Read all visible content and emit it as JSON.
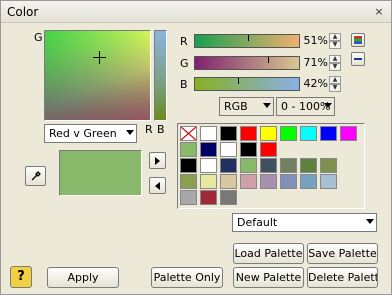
{
  "window": {
    "title": "Color",
    "close_glyph": "×"
  },
  "picker": {
    "axis_g": "G",
    "axis_r": "R",
    "axis_b": "B",
    "mode": "Red v Green"
  },
  "sliders": [
    {
      "label": "R",
      "value": "51%",
      "fraction": 0.51
    },
    {
      "label": "G",
      "value": "71%",
      "fraction": 0.71
    },
    {
      "label": "B",
      "value": "42%",
      "fraction": 0.42
    }
  ],
  "format": {
    "model": "RGB",
    "range": "0 - 100%"
  },
  "current_color": "#88b86a",
  "palette": {
    "selected": "Default",
    "rows": [
      [
        "none",
        "#ffffff",
        "#000000",
        "#ff0000",
        "#ffff00",
        "#00ff00",
        "#00ffff",
        "#0000ff",
        "#ff00ff"
      ],
      [
        "#88b86a",
        "#000066",
        "#ffffff",
        "#000000",
        "#ff0000",
        "",
        "",
        "",
        ""
      ],
      [
        "#000000",
        "#ffffff",
        "#203060",
        "#88b86a",
        "#405060",
        "#708060",
        "#608040",
        "#809050",
        ""
      ],
      [
        "#8aa050",
        "#e8e8a0",
        "#d8c8a0",
        "#d0a0a8",
        "#a890b0",
        "#8090b8",
        "#78a0c0",
        "#a8c0d0",
        ""
      ],
      [
        "#a8a8a8",
        "#a02838",
        "#787878",
        "",
        "",
        "",
        "",
        "",
        ""
      ]
    ]
  },
  "buttons": {
    "apply": "Apply",
    "palette_only": "Palette Only",
    "load_palette": "Load Palette",
    "save_palette": "Save Palette",
    "new_palette": "New Palette",
    "delete_palette": "Delete Palette",
    "help": "?"
  }
}
